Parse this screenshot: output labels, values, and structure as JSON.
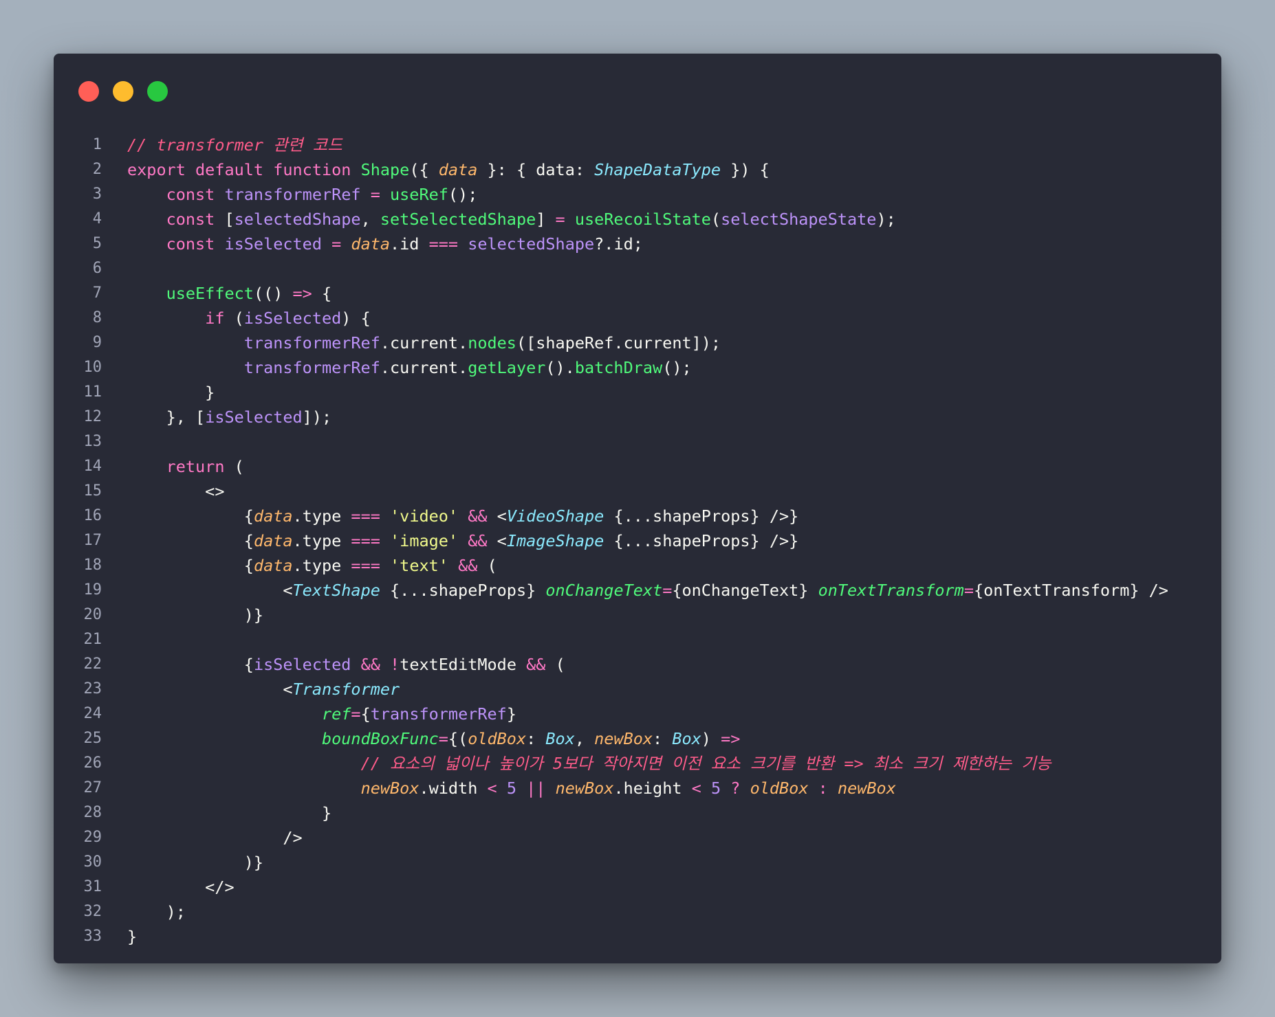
{
  "window": {
    "dots": [
      {
        "name": "close",
        "color": "#ff5f57"
      },
      {
        "name": "minimize",
        "color": "#febc2e"
      },
      {
        "name": "maximize",
        "color": "#28c840"
      }
    ]
  },
  "code": {
    "lines": [
      {
        "n": "1",
        "tokens": [
          [
            "comment",
            "// transformer 관련 코드"
          ]
        ]
      },
      {
        "n": "2",
        "tokens": [
          [
            "keyword",
            "export default function "
          ],
          [
            "func",
            "Shape"
          ],
          [
            "plain",
            "({ "
          ],
          [
            "param",
            "data"
          ],
          [
            "plain",
            " }: { data: "
          ],
          [
            "type",
            "ShapeDataType"
          ],
          [
            "plain",
            " }) {"
          ]
        ]
      },
      {
        "n": "3",
        "tokens": [
          [
            "plain",
            "    "
          ],
          [
            "keyword",
            "const "
          ],
          [
            "var",
            "transformerRef"
          ],
          [
            "keyword",
            " = "
          ],
          [
            "func",
            "useRef"
          ],
          [
            "plain",
            "();"
          ]
        ]
      },
      {
        "n": "4",
        "tokens": [
          [
            "plain",
            "    "
          ],
          [
            "keyword",
            "const "
          ],
          [
            "plain",
            "["
          ],
          [
            "var",
            "selectedShape"
          ],
          [
            "plain",
            ", "
          ],
          [
            "func",
            "setSelectedShape"
          ],
          [
            "plain",
            "] "
          ],
          [
            "keyword",
            "= "
          ],
          [
            "func",
            "useRecoilState"
          ],
          [
            "plain",
            "("
          ],
          [
            "var",
            "selectShapeState"
          ],
          [
            "plain",
            ");"
          ]
        ]
      },
      {
        "n": "5",
        "tokens": [
          [
            "plain",
            "    "
          ],
          [
            "keyword",
            "const "
          ],
          [
            "var",
            "isSelected"
          ],
          [
            "keyword",
            " = "
          ],
          [
            "param",
            "data"
          ],
          [
            "plain",
            ".id "
          ],
          [
            "keyword",
            "==="
          ],
          [
            "plain",
            " "
          ],
          [
            "var",
            "selectedShape"
          ],
          [
            "plain",
            "?.id;"
          ]
        ]
      },
      {
        "n": "6",
        "tokens": []
      },
      {
        "n": "7",
        "tokens": [
          [
            "plain",
            "    "
          ],
          [
            "func",
            "useEffect"
          ],
          [
            "plain",
            "(() "
          ],
          [
            "keyword",
            "=>"
          ],
          [
            "plain",
            " {"
          ]
        ]
      },
      {
        "n": "8",
        "tokens": [
          [
            "plain",
            "        "
          ],
          [
            "keyword",
            "if "
          ],
          [
            "plain",
            "("
          ],
          [
            "var",
            "isSelected"
          ],
          [
            "plain",
            ") {"
          ]
        ]
      },
      {
        "n": "9",
        "tokens": [
          [
            "plain",
            "            "
          ],
          [
            "var",
            "transformerRef"
          ],
          [
            "plain",
            ".current."
          ],
          [
            "func",
            "nodes"
          ],
          [
            "plain",
            "([shapeRef.current]);"
          ]
        ]
      },
      {
        "n": "10",
        "tokens": [
          [
            "plain",
            "            "
          ],
          [
            "var",
            "transformerRef"
          ],
          [
            "plain",
            ".current."
          ],
          [
            "func",
            "getLayer"
          ],
          [
            "plain",
            "()."
          ],
          [
            "func",
            "batchDraw"
          ],
          [
            "plain",
            "();"
          ]
        ]
      },
      {
        "n": "11",
        "tokens": [
          [
            "plain",
            "        }"
          ]
        ]
      },
      {
        "n": "12",
        "tokens": [
          [
            "plain",
            "    }, ["
          ],
          [
            "var",
            "isSelected"
          ],
          [
            "plain",
            "]);"
          ]
        ]
      },
      {
        "n": "13",
        "tokens": []
      },
      {
        "n": "14",
        "tokens": [
          [
            "plain",
            "    "
          ],
          [
            "keyword",
            "return"
          ],
          [
            "plain",
            " ("
          ]
        ]
      },
      {
        "n": "15",
        "tokens": [
          [
            "plain",
            "        <>"
          ]
        ]
      },
      {
        "n": "16",
        "tokens": [
          [
            "plain",
            "            {"
          ],
          [
            "param",
            "data"
          ],
          [
            "plain",
            ".type "
          ],
          [
            "keyword",
            "==="
          ],
          [
            "plain",
            " "
          ],
          [
            "string",
            "'video'"
          ],
          [
            "plain",
            " "
          ],
          [
            "keyword",
            "&&"
          ],
          [
            "plain",
            " <"
          ],
          [
            "tag",
            "VideoShape"
          ],
          [
            "plain",
            " {...shapeProps} />}"
          ]
        ]
      },
      {
        "n": "17",
        "tokens": [
          [
            "plain",
            "            {"
          ],
          [
            "param",
            "data"
          ],
          [
            "plain",
            ".type "
          ],
          [
            "keyword",
            "==="
          ],
          [
            "plain",
            " "
          ],
          [
            "string",
            "'image'"
          ],
          [
            "plain",
            " "
          ],
          [
            "keyword",
            "&&"
          ],
          [
            "plain",
            " <"
          ],
          [
            "tag",
            "ImageShape"
          ],
          [
            "plain",
            " {...shapeProps} />}"
          ]
        ]
      },
      {
        "n": "18",
        "tokens": [
          [
            "plain",
            "            {"
          ],
          [
            "param",
            "data"
          ],
          [
            "plain",
            ".type "
          ],
          [
            "keyword",
            "==="
          ],
          [
            "plain",
            " "
          ],
          [
            "string",
            "'text'"
          ],
          [
            "plain",
            " "
          ],
          [
            "keyword",
            "&&"
          ],
          [
            "plain",
            " ("
          ]
        ]
      },
      {
        "n": "19",
        "tokens": [
          [
            "plain",
            "                <"
          ],
          [
            "tag",
            "TextShape"
          ],
          [
            "plain",
            " {...shapeProps} "
          ],
          [
            "attr",
            "onChangeText"
          ],
          [
            "keyword",
            "="
          ],
          [
            "plain",
            "{onChangeText} "
          ],
          [
            "attr",
            "onTextTransform"
          ],
          [
            "keyword",
            "="
          ],
          [
            "plain",
            "{onTextTransform} />"
          ]
        ]
      },
      {
        "n": "20",
        "tokens": [
          [
            "plain",
            "            )}"
          ]
        ]
      },
      {
        "n": "21",
        "tokens": []
      },
      {
        "n": "22",
        "tokens": [
          [
            "plain",
            "            {"
          ],
          [
            "var",
            "isSelected"
          ],
          [
            "plain",
            " "
          ],
          [
            "keyword",
            "&&"
          ],
          [
            "plain",
            " "
          ],
          [
            "keyword",
            "!"
          ],
          [
            "plain",
            "textEditMode "
          ],
          [
            "keyword",
            "&&"
          ],
          [
            "plain",
            " ("
          ]
        ]
      },
      {
        "n": "23",
        "tokens": [
          [
            "plain",
            "                <"
          ],
          [
            "tag",
            "Transformer"
          ]
        ]
      },
      {
        "n": "24",
        "tokens": [
          [
            "plain",
            "                    "
          ],
          [
            "attr",
            "ref"
          ],
          [
            "keyword",
            "="
          ],
          [
            "plain",
            "{"
          ],
          [
            "var",
            "transformerRef"
          ],
          [
            "plain",
            "}"
          ]
        ]
      },
      {
        "n": "25",
        "tokens": [
          [
            "plain",
            "                    "
          ],
          [
            "attr",
            "boundBoxFunc"
          ],
          [
            "keyword",
            "="
          ],
          [
            "plain",
            "{("
          ],
          [
            "param",
            "oldBox"
          ],
          [
            "plain",
            ": "
          ],
          [
            "type",
            "Box"
          ],
          [
            "plain",
            ", "
          ],
          [
            "param",
            "newBox"
          ],
          [
            "plain",
            ": "
          ],
          [
            "type",
            "Box"
          ],
          [
            "plain",
            ") "
          ],
          [
            "keyword",
            "=>"
          ]
        ]
      },
      {
        "n": "26",
        "tokens": [
          [
            "plain",
            "                        "
          ],
          [
            "comment",
            "// 요소의 넓이나 높이가 5보다 작아지면 이전 요소 크기를 반환 => 최소 크기 제한하는 기능"
          ]
        ]
      },
      {
        "n": "27",
        "tokens": [
          [
            "plain",
            "                        "
          ],
          [
            "param",
            "newBox"
          ],
          [
            "plain",
            ".width "
          ],
          [
            "keyword",
            "<"
          ],
          [
            "plain",
            " "
          ],
          [
            "number",
            "5"
          ],
          [
            "plain",
            " "
          ],
          [
            "keyword",
            "||"
          ],
          [
            "plain",
            " "
          ],
          [
            "param",
            "newBox"
          ],
          [
            "plain",
            ".height "
          ],
          [
            "keyword",
            "<"
          ],
          [
            "plain",
            " "
          ],
          [
            "number",
            "5"
          ],
          [
            "plain",
            " "
          ],
          [
            "keyword",
            "?"
          ],
          [
            "plain",
            " "
          ],
          [
            "param",
            "oldBox"
          ],
          [
            "plain",
            " "
          ],
          [
            "keyword",
            ":"
          ],
          [
            "plain",
            " "
          ],
          [
            "param",
            "newBox"
          ]
        ]
      },
      {
        "n": "28",
        "tokens": [
          [
            "plain",
            "                    }"
          ]
        ]
      },
      {
        "n": "29",
        "tokens": [
          [
            "plain",
            "                />"
          ]
        ]
      },
      {
        "n": "30",
        "tokens": [
          [
            "plain",
            "            )}"
          ]
        ]
      },
      {
        "n": "31",
        "tokens": [
          [
            "plain",
            "        </>"
          ]
        ]
      },
      {
        "n": "32",
        "tokens": [
          [
            "plain",
            "    );"
          ]
        ]
      },
      {
        "n": "33",
        "tokens": [
          [
            "plain",
            "}"
          ]
        ]
      }
    ]
  }
}
